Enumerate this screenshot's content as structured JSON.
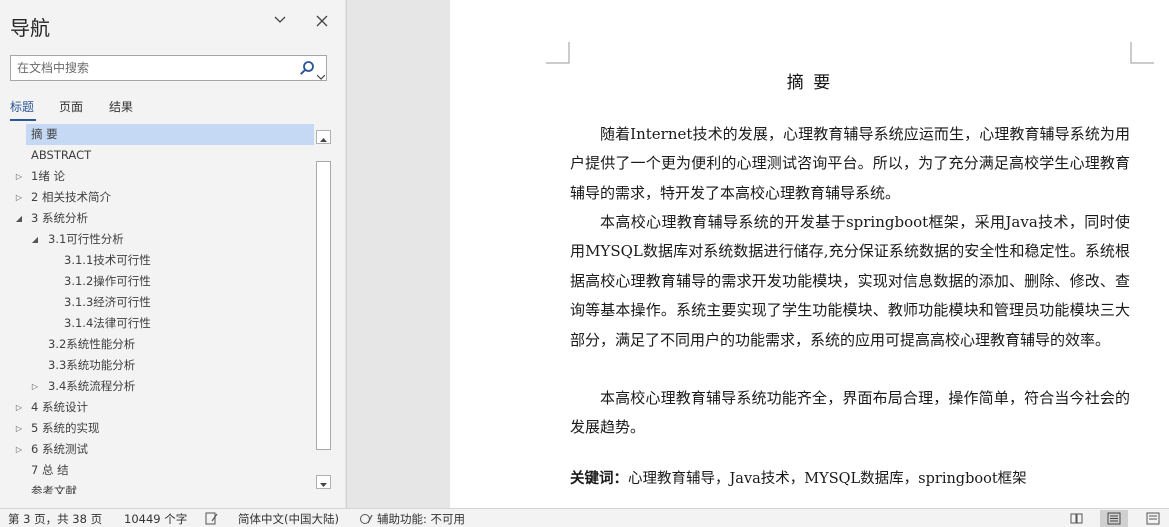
{
  "nav": {
    "title": "导航",
    "search_placeholder": "在文档中搜索",
    "tabs": [
      "标题",
      "页面",
      "结果"
    ],
    "tree": [
      {
        "label": "摘  要",
        "level": 1,
        "toggle": "none",
        "selected": true
      },
      {
        "label": "ABSTRACT",
        "level": 1,
        "toggle": "none"
      },
      {
        "label": "1绪  论",
        "level": 1,
        "toggle": "collapsed"
      },
      {
        "label": "2 相关技术简介",
        "level": 1,
        "toggle": "collapsed"
      },
      {
        "label": "3 系统分析",
        "level": 1,
        "toggle": "expanded"
      },
      {
        "label": "3.1可行性分析",
        "level": 2,
        "toggle": "expanded"
      },
      {
        "label": "3.1.1技术可行性",
        "level": 3,
        "toggle": "none"
      },
      {
        "label": "3.1.2操作可行性",
        "level": 3,
        "toggle": "none"
      },
      {
        "label": "3.1.3经济可行性",
        "level": 3,
        "toggle": "none"
      },
      {
        "label": "3.1.4法律可行性",
        "level": 3,
        "toggle": "none"
      },
      {
        "label": "3.2系统性能分析",
        "level": 2,
        "toggle": "none"
      },
      {
        "label": "3.3系统功能分析",
        "level": 2,
        "toggle": "none"
      },
      {
        "label": "3.4系统流程分析",
        "level": 2,
        "toggle": "collapsed"
      },
      {
        "label": "4 系统设计",
        "level": 1,
        "toggle": "collapsed"
      },
      {
        "label": "5 系统的实现",
        "level": 1,
        "toggle": "collapsed"
      },
      {
        "label": "6 系统测试",
        "level": 1,
        "toggle": "collapsed"
      },
      {
        "label": "7 总  结",
        "level": 1,
        "toggle": "none"
      },
      {
        "label": "参考文献",
        "level": 1,
        "toggle": "none"
      }
    ]
  },
  "document": {
    "title": "摘  要",
    "paragraphs": [
      "随着Internet技术的发展，心理教育辅导系统应运而生，心理教育辅导系统为用户提供了一个更为便利的心理测试咨询平台。所以，为了充分满足高校学生心理教育辅导的需求，特开发了本高校心理教育辅导系统。",
      "本高校心理教育辅导系统的开发基于springboot框架，采用Java技术，同时使用MYSQL数据库对系统数据进行储存,充分保证系统数据的安全性和稳定性。系统根据高校心理教育辅导的需求开发功能模块，实现对信息数据的添加、删除、修改、查询等基本操作。系统主要实现了学生功能模块、教师功能模块和管理员功能模块三大部分，满足了不同用户的功能需求，系统的应用可提高高校心理教育辅导的效率。",
      "本高校心理教育辅导系统功能齐全，界面布局合理，操作简单，符合当今社会的发展趋势。"
    ],
    "keywords_label": "关键词：",
    "keywords": "心理教育辅导，Java技术，MYSQL数据库，springboot框架"
  },
  "status": {
    "page": "第 3 页，共 38 页",
    "words": "10449 个字",
    "language": "简体中文(中国大陆)",
    "accessibility": "辅助功能: 不可用"
  },
  "colors": {
    "accent": "#2b579a",
    "selection": "#c5d9f4"
  }
}
